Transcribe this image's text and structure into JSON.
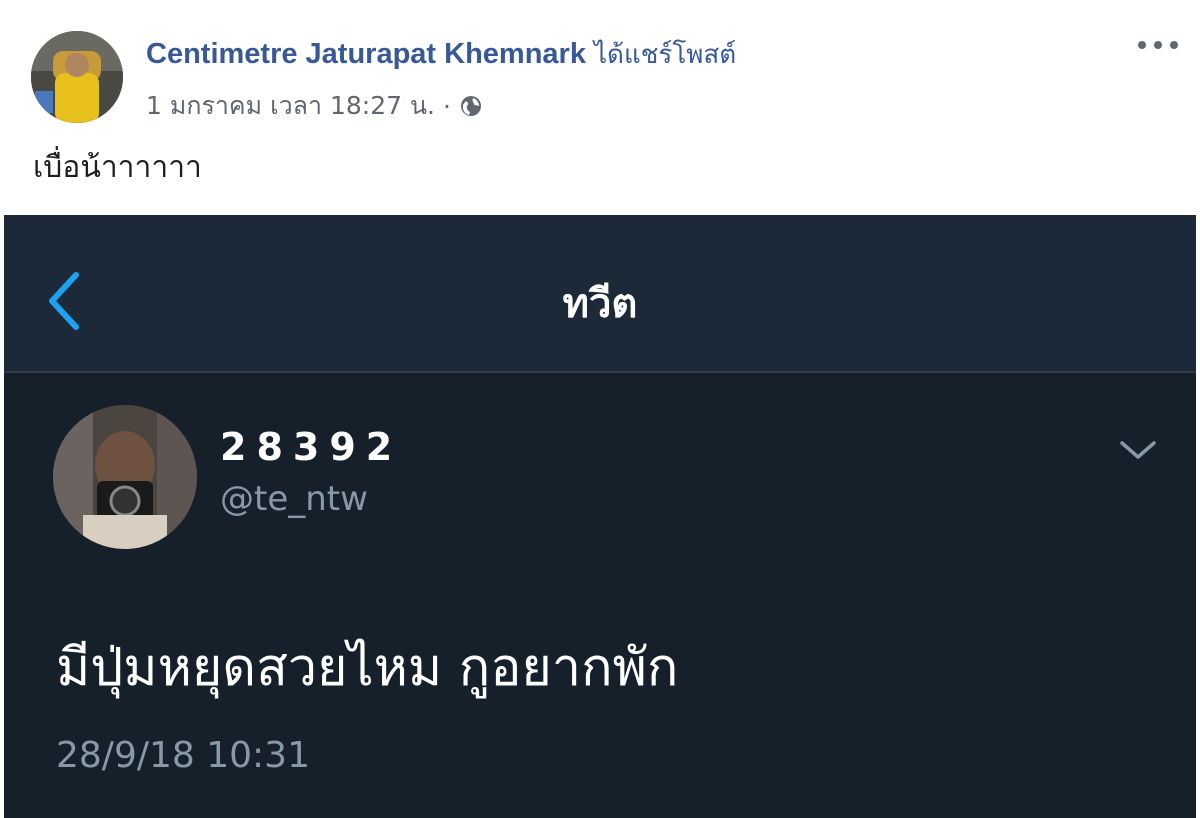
{
  "post": {
    "author": "Centimetre Jaturapat Khemnark",
    "action": "ได้แชร์โพสต์",
    "date": "1 มกราคม เวลา 18:27 น.",
    "separator": "·",
    "privacy_icon": "globe-icon",
    "more_icon": "more-options-icon",
    "text": "เบื่อน้าาาาาา"
  },
  "tweet": {
    "nav_title": "ทวีต",
    "back_icon": "chevron-left-icon",
    "display_name": "28392",
    "handle": "@te_ntw",
    "menu_icon": "chevron-down-icon",
    "body": "มีปุ่มหยุดสวยไหม กูอยากพัก",
    "timestamp": "28/9/18 10:31"
  },
  "colors": {
    "fb_link": "#385898",
    "tweet_bg": "#15202b",
    "tweet_nav_bg": "#1c2938",
    "tweet_accent": "#1da1f2",
    "tweet_secondary": "#8899a6"
  }
}
